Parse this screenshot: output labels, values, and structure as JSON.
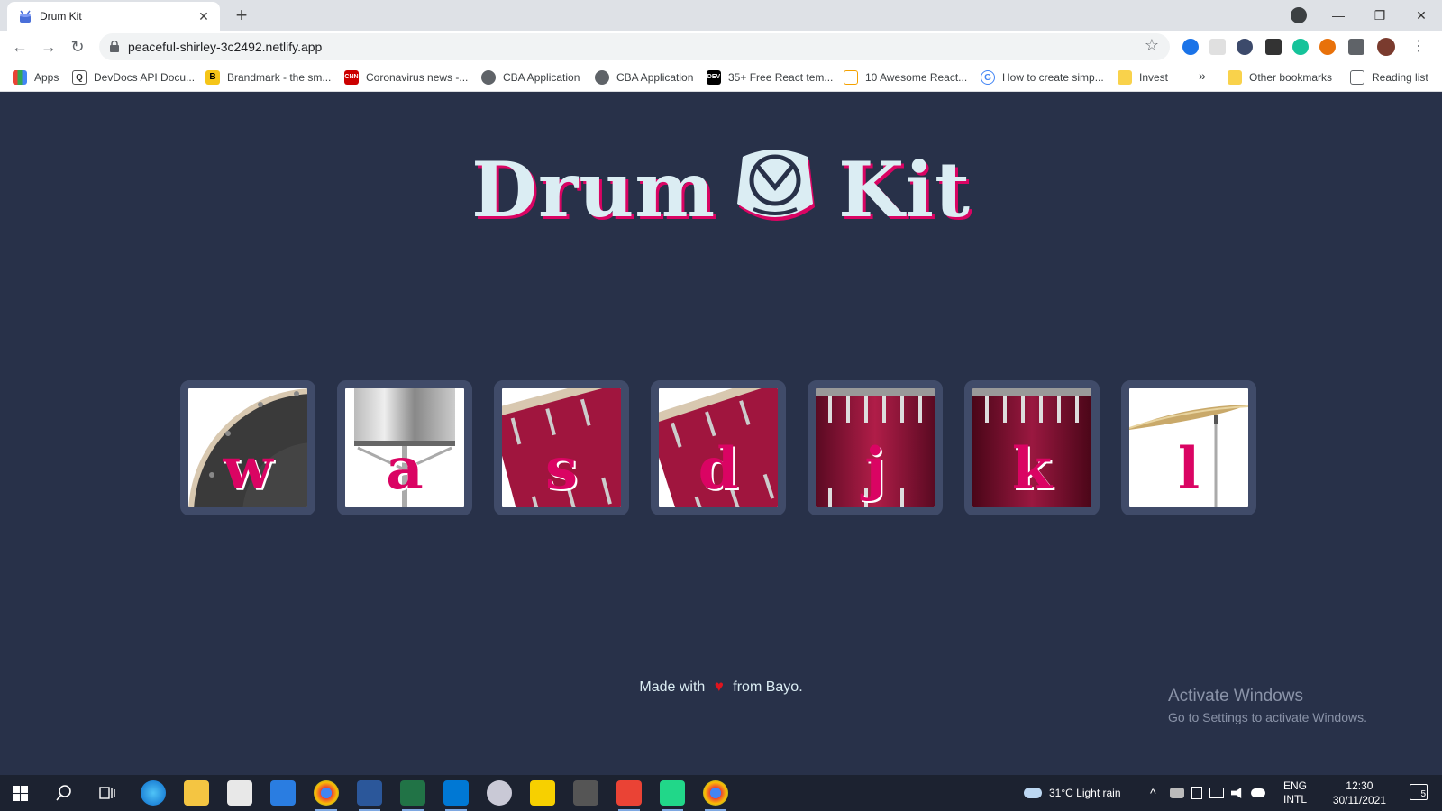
{
  "browser": {
    "tab_title": "Drum Kit",
    "new_tab": "+",
    "url": "peaceful-shirley-3c2492.netlify.app",
    "window_controls": {
      "minimize": "—",
      "restore": "❐",
      "close": "✕"
    },
    "nav": {
      "back": "←",
      "forward": "→",
      "reload": "↻",
      "star": "☆",
      "menu": "⋮"
    }
  },
  "bookmarks": [
    {
      "label": "Apps",
      "icon": "apps-grid-icon"
    },
    {
      "label": "DevDocs API Docu...",
      "icon": "devdocs-icon"
    },
    {
      "label": "Brandmark - the sm...",
      "icon": "brandmark-icon"
    },
    {
      "label": "Coronavirus news -...",
      "icon": "cnn-icon"
    },
    {
      "label": "CBA Application",
      "icon": "globe-icon"
    },
    {
      "label": "CBA Application",
      "icon": "globe-icon"
    },
    {
      "label": "35+ Free React tem...",
      "icon": "dev-icon"
    },
    {
      "label": "10 Awesome React...",
      "icon": "chart-icon"
    },
    {
      "label": "How to create simp...",
      "icon": "google-icon"
    },
    {
      "label": "Invest",
      "icon": "folder-icon"
    },
    {
      "label": "»",
      "icon": ""
    },
    {
      "label": "Other bookmarks",
      "icon": "folder-icon"
    },
    {
      "label": "Reading list",
      "icon": "reading-list-icon"
    }
  ],
  "page": {
    "title_left": "Drum",
    "title_right": "Kit",
    "drums": [
      {
        "key": "w",
        "name": "crash"
      },
      {
        "key": "a",
        "name": "snare"
      },
      {
        "key": "s",
        "name": "tom-1"
      },
      {
        "key": "d",
        "name": "tom-2"
      },
      {
        "key": "j",
        "name": "tom-3"
      },
      {
        "key": "k",
        "name": "tom-4"
      },
      {
        "key": "l",
        "name": "cymbal"
      }
    ],
    "footer_before": "Made with",
    "footer_heart": "♥",
    "footer_after": "from Bayo."
  },
  "watermark": {
    "line1": "Activate Windows",
    "line2": "Go to Settings to activate Windows."
  },
  "taskbar": {
    "weather": "31°C  Light rain",
    "lang_top": "ENG",
    "lang_bottom": "INTL",
    "time": "12:30",
    "date": "30/11/2021",
    "notifications": "5"
  },
  "colors": {
    "page_bg": "#283149",
    "accent": "#da0463",
    "tile_border": "#404b69",
    "title_text": "#dbedf3"
  }
}
